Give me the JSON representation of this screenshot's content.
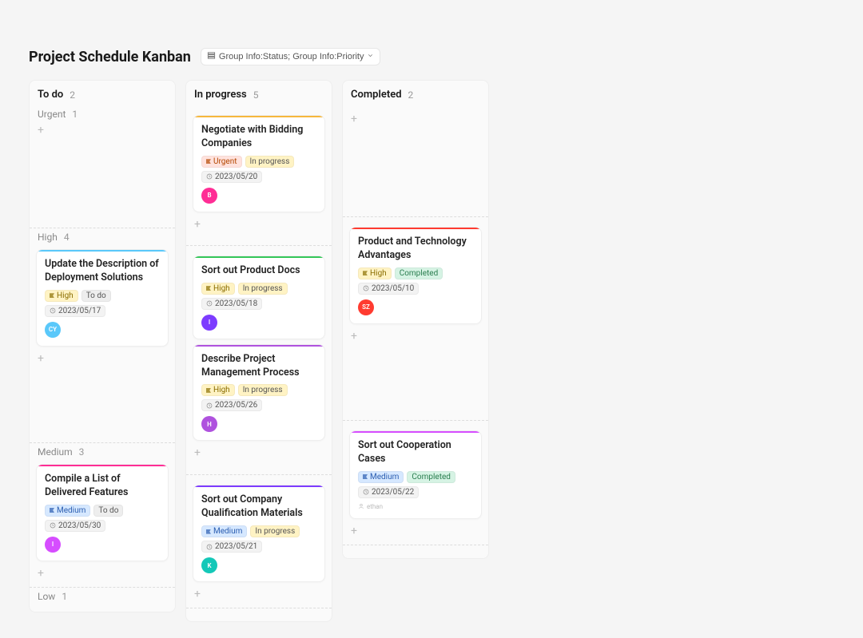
{
  "title": "Project Schedule Kanban",
  "group_button_label": "Group Info:Status; Group Info:Priority",
  "columns": [
    {
      "id": "todo",
      "name": "To do",
      "count": 2
    },
    {
      "id": "inprog",
      "name": "In progress",
      "count": 5
    },
    {
      "id": "done",
      "name": "Completed",
      "count": 2
    }
  ],
  "priority_rows": [
    {
      "id": "urgent",
      "name": "Urgent",
      "count": 1
    },
    {
      "id": "high",
      "name": "High",
      "count": 4
    },
    {
      "id": "medium",
      "name": "Medium",
      "count": 3
    },
    {
      "id": "low",
      "name": "Low",
      "count": 1
    }
  ],
  "tag_colors": {
    "priority": {
      "Urgent": "#ffe2dd",
      "High": "#fff3c4",
      "Medium": "#d6e8ff",
      "Low": "#eee"
    },
    "status": {
      "To do": "#eeeeee",
      "In progress": "#fff3c4",
      "Completed": "#d6f3e4"
    },
    "date": "#f3f3f3"
  },
  "card_top_colors": {
    "urgent": "#f6b73c",
    "high_todo": "#5ac8fa",
    "high_inprog_1": "#34c759",
    "high_done": "#ff3b30",
    "high_inprog_2": "#af52de",
    "medium_todo": "#ff2d95",
    "medium_inprog": "#7d3cff",
    "medium_done": "#d64dff"
  },
  "avatar_colors": {
    "B": "#ff2d95",
    "CY": "#5ac8fa",
    "I": "#7d3cff",
    "H": "#af52de",
    "SZ": "#ff3b30",
    "K": "#14c8b8",
    "Ipink": "#d64dff"
  },
  "cards": {
    "urgent": {
      "inprog": {
        "title": "Negotiate with Bidding Companies",
        "priority": "Urgent",
        "status": "In progress",
        "date": "2023/05/20",
        "avatar": "B",
        "top_color_key": "urgent"
      }
    },
    "high": {
      "todo": {
        "title": "Update the Description of Deployment Solutions",
        "priority": "High",
        "status": "To do",
        "date": "2023/05/17",
        "avatar": "CY",
        "top_color_key": "high_todo"
      },
      "inprog1": {
        "title": "Sort out Product Docs",
        "priority": "High",
        "status": "In progress",
        "date": "2023/05/18",
        "avatar": "I",
        "top_color_key": "high_inprog_1"
      },
      "inprog2": {
        "title": "Describe Project Management Process",
        "priority": "High",
        "status": "In progress",
        "date": "2023/05/26",
        "avatar": "H",
        "top_color_key": "high_inprog_2"
      },
      "done": {
        "title": "Product and Technology Advantages",
        "priority": "High",
        "status": "Completed",
        "date": "2023/05/10",
        "avatar": "SZ",
        "top_color_key": "high_done"
      }
    },
    "medium": {
      "todo": {
        "title": "Compile a List of Delivered Features",
        "priority": "Medium",
        "status": "To do",
        "date": "2023/05/30",
        "avatar": "Ipink",
        "avatar_label": "I",
        "top_color_key": "medium_todo"
      },
      "inprog": {
        "title": "Sort out Company Qualification Materials",
        "priority": "Medium",
        "status": "In progress",
        "date": "2023/05/21",
        "avatar": "K",
        "top_color_key": "medium_inprog"
      },
      "done": {
        "title": "Sort out Cooperation Cases",
        "priority": "Medium",
        "status": "Completed",
        "date": "2023/05/22",
        "creator_text": "ethan",
        "top_color_key": "medium_done"
      }
    }
  }
}
